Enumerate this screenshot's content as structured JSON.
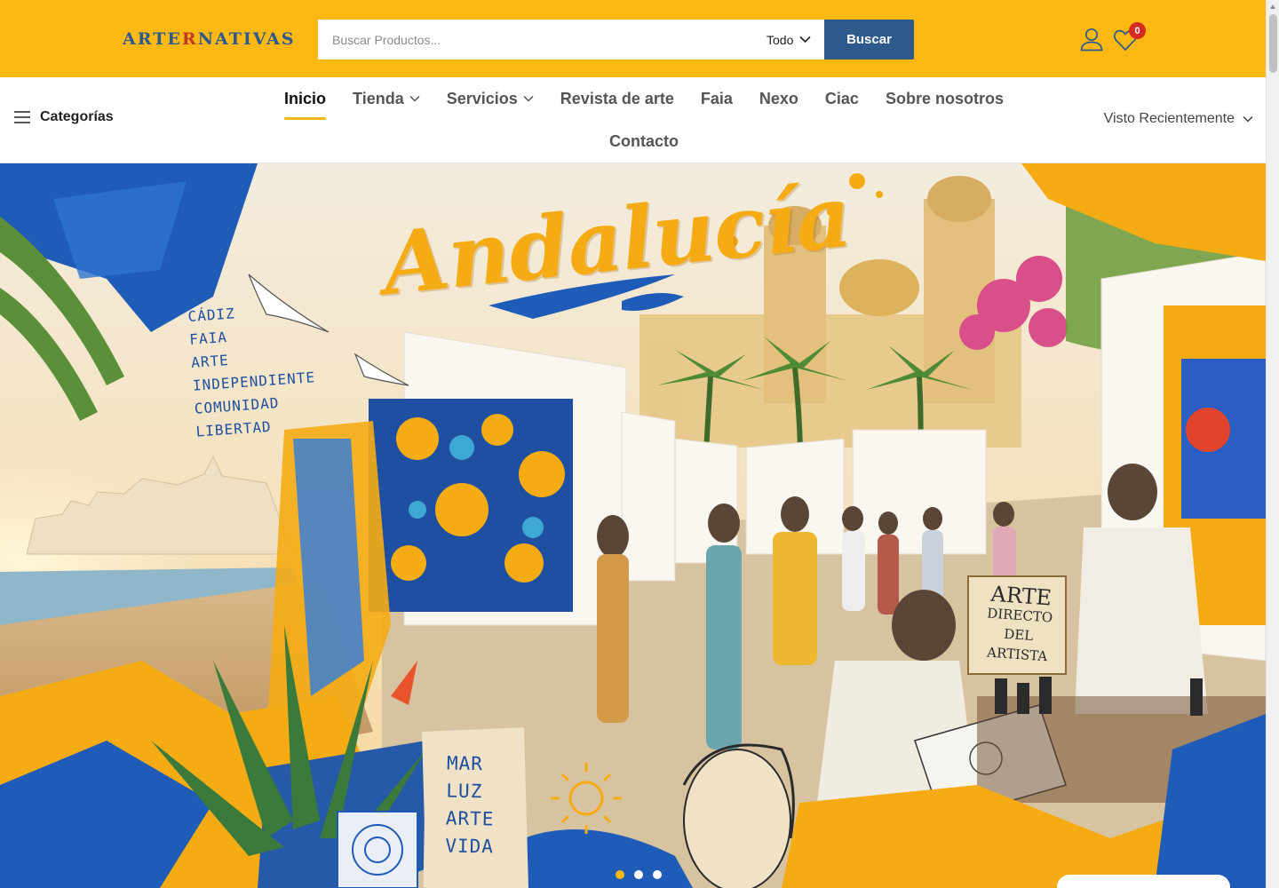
{
  "header": {
    "logo_prefix": "ARTE",
    "logo_r": "R",
    "logo_suffix": "NATIVAS",
    "search_placeholder": "Buscar Productos...",
    "category_select": "Todo",
    "search_button": "Buscar",
    "wishlist_count": "0",
    "icons": [
      "user-icon",
      "heart-icon",
      "chevron-down-icon"
    ]
  },
  "nav": {
    "categories_label": "Categorías",
    "items": [
      {
        "label": "Inicio",
        "active": true,
        "dropdown": false
      },
      {
        "label": "Tienda",
        "active": false,
        "dropdown": true
      },
      {
        "label": "Servicios",
        "active": false,
        "dropdown": true
      },
      {
        "label": "Revista de arte",
        "active": false,
        "dropdown": false
      },
      {
        "label": "Faia",
        "active": false,
        "dropdown": false
      },
      {
        "label": "Nexo",
        "active": false,
        "dropdown": false
      },
      {
        "label": "Ciac",
        "active": false,
        "dropdown": false
      },
      {
        "label": "Sobre nosotros",
        "active": false,
        "dropdown": false
      },
      {
        "label": "Contacto",
        "active": false,
        "dropdown": false
      }
    ],
    "recent_label": "Visto Recientemente"
  },
  "hero": {
    "title": "Andalucía",
    "handwritten_list": [
      "CÁDIZ",
      "FAIA",
      "ARTE",
      "INDEPENDIENTE",
      "COMUNIDAD",
      "LIBERTAD"
    ],
    "sign": {
      "line1": "ARTE",
      "line2": "DIRECTO",
      "line3": "DEL ARTISTA"
    },
    "card": [
      "MAR",
      "LUZ",
      "ARTE",
      "VIDA"
    ],
    "slides": 3,
    "active_slide": 1
  },
  "colors": {
    "brand_yellow": "#fdb813",
    "brand_blue": "#2d5a8a",
    "badge_red": "#d62b1f"
  }
}
